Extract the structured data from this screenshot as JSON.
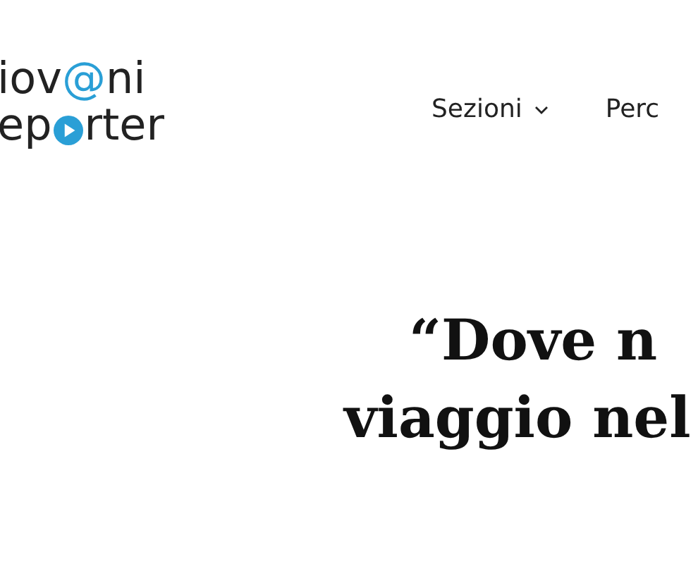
{
  "logo": {
    "top": [
      {
        "text": "iov",
        "accent": false
      },
      {
        "text": "@",
        "accent": true
      },
      {
        "text": "ni",
        "accent": false
      }
    ],
    "bottom_start": "ep",
    "bottom_end": "rter"
  },
  "nav": [
    {
      "label": "Sezioni",
      "has_menu": true
    },
    {
      "label": "Perc",
      "has_menu": false
    }
  ],
  "headline": [
    "“Dove n",
    "viaggio nel"
  ]
}
